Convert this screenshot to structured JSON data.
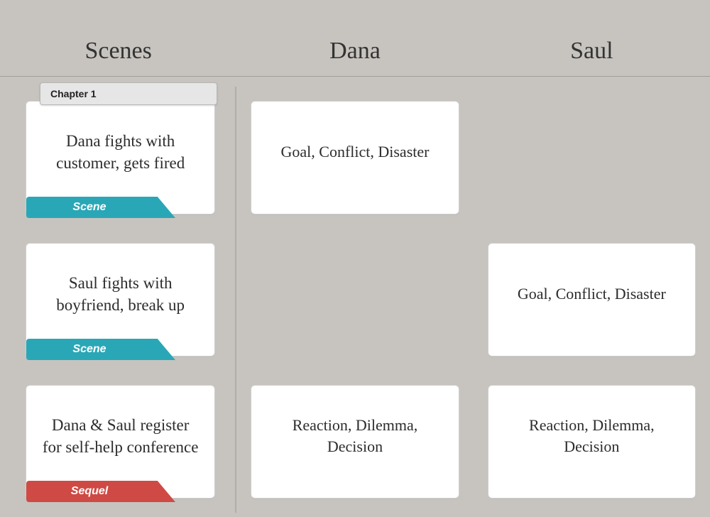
{
  "header": {
    "col1": "Scenes",
    "col2": "Dana",
    "col3": "Saul"
  },
  "chapter_label": "Chapter 1",
  "tags": {
    "scene": "Scene",
    "sequel": "Sequel"
  },
  "rows": [
    {
      "scene": {
        "text": "Dana fights with customer, gets fired",
        "tag": "scene"
      },
      "dana": {
        "text": "Goal, Conflict, Disaster"
      },
      "saul": null
    },
    {
      "scene": {
        "text": "Saul fights with boyfriend, break up",
        "tag": "scene"
      },
      "dana": null,
      "saul": {
        "text": "Goal, Conflict, Disaster"
      }
    },
    {
      "scene": {
        "text": "Dana & Saul register for self-help conference",
        "tag": "sequel"
      },
      "dana": {
        "text": "Reaction, Dilemma, Decision"
      },
      "saul": {
        "text": "Reaction, Dilemma, Decision"
      }
    }
  ]
}
